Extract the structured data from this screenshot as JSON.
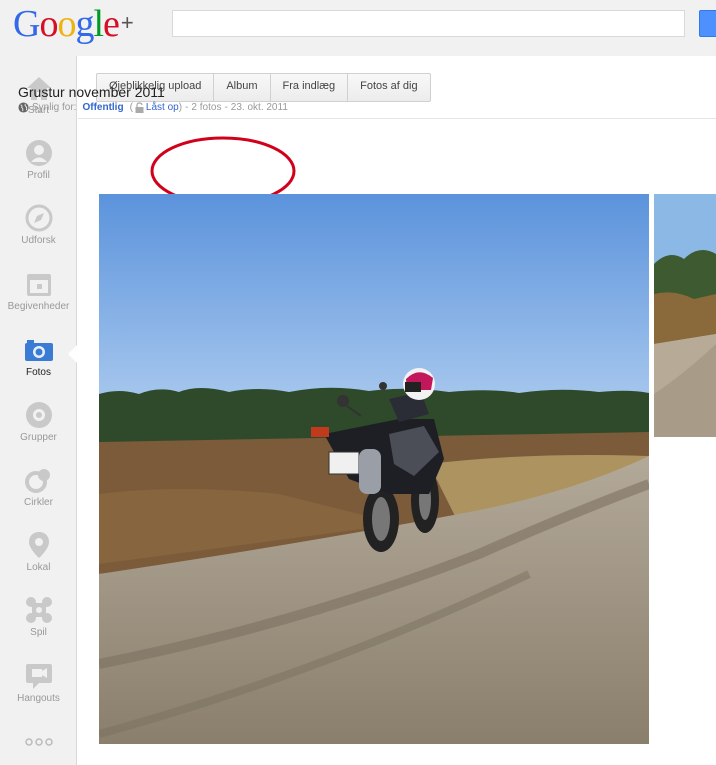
{
  "header": {
    "logo": {
      "c1": "G",
      "c2": "o",
      "c3": "o",
      "c4": "g",
      "c5": "l",
      "c6": "e",
      "plus": "+"
    },
    "search": {
      "value": "",
      "placeholder": ""
    }
  },
  "leftnav": {
    "active": "Fotos",
    "items": [
      {
        "label": "Start",
        "icon": "home-icon"
      },
      {
        "label": "Profil",
        "icon": "profile-icon"
      },
      {
        "label": "Udforsk",
        "icon": "compass-icon"
      },
      {
        "label": "Begivenheder",
        "icon": "calendar-icon"
      },
      {
        "label": "Fotos",
        "icon": "camera-icon"
      },
      {
        "label": "Grupper",
        "icon": "groups-icon"
      },
      {
        "label": "Cirkler",
        "icon": "circles-icon"
      },
      {
        "label": "Lokal",
        "icon": "location-pin-icon"
      },
      {
        "label": "Spil",
        "icon": "games-icon"
      },
      {
        "label": "Hangouts",
        "icon": "hangouts-icon"
      },
      {
        "label": "",
        "icon": "more-dots-icon"
      }
    ]
  },
  "tabs": [
    "Øjeblikkelig upload",
    "Album",
    "Fra indlæg",
    "Fotos af dig"
  ],
  "album": {
    "title": "Grustur november 2011",
    "visibility_prefix": "Synlig for:",
    "visibility_value": "Offentlig",
    "lock_label": "Låst op",
    "photo_count": "2 fotos",
    "date": "23. okt. 2011"
  },
  "colors": {
    "accent_link": "#3366cc",
    "annotation_circle": "#d0021b",
    "nav_icon": "#c9c9c9",
    "nav_active_icon": "#3a7bd5"
  }
}
